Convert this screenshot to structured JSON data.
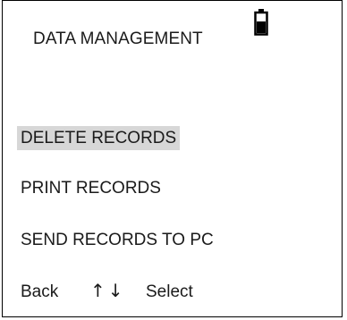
{
  "header": {
    "title": "DATA MANAGEMENT",
    "battery_icon": "battery-icon"
  },
  "menu": {
    "items": [
      {
        "label": "DELETE RECORDS",
        "selected": true
      },
      {
        "label": "PRINT RECORDS",
        "selected": false
      },
      {
        "label": "SEND RECORDS TO PC",
        "selected": false
      }
    ]
  },
  "footer": {
    "back_label": "Back",
    "nav_arrows": "↑↓",
    "select_label": "Select"
  },
  "colors": {
    "selection_bg": "#d7d7d7",
    "text": "#1a1a1a",
    "border": "#000000"
  }
}
